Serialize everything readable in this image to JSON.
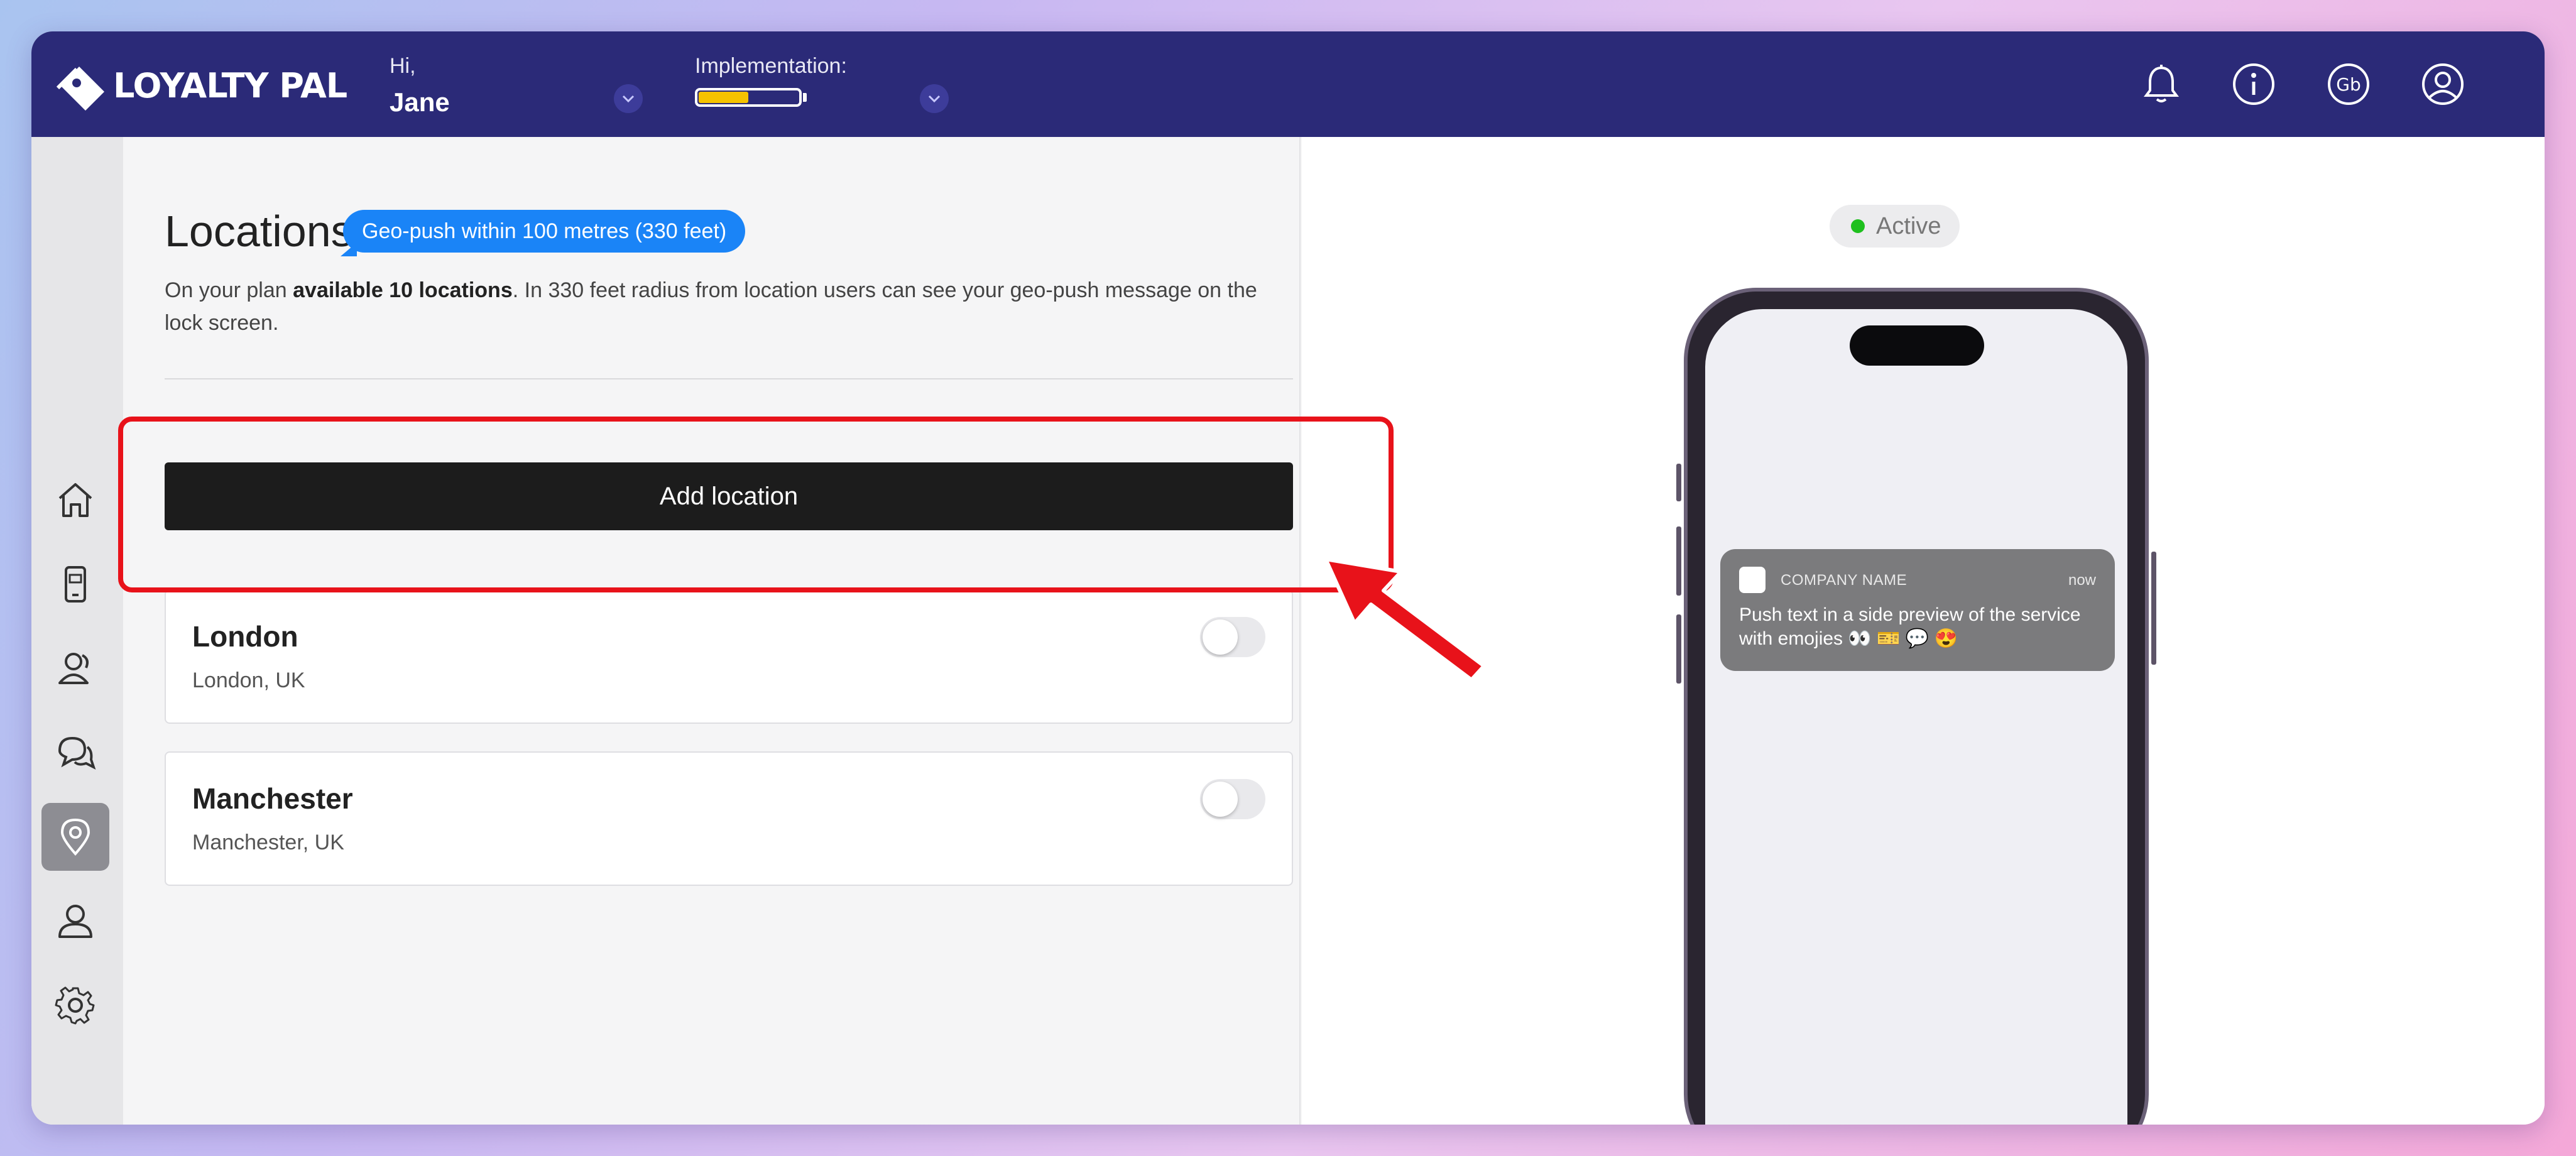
{
  "header": {
    "brand": "LOYALTY PAL",
    "greeting": "Hi,",
    "user_name": "Jane",
    "implementation_label": "Implementation:",
    "implementation_progress": 0.5
  },
  "rail": {
    "items": [
      {
        "name": "home",
        "icon": "home-icon",
        "active": false
      },
      {
        "name": "cards",
        "icon": "phone-card-icon",
        "active": false
      },
      {
        "name": "customers",
        "icon": "users-icon",
        "active": false
      },
      {
        "name": "messages",
        "icon": "chat-icon",
        "active": false
      },
      {
        "name": "locations",
        "icon": "location-pin-icon",
        "active": true
      },
      {
        "name": "account",
        "icon": "user-icon",
        "active": false
      },
      {
        "name": "settings",
        "icon": "gear-icon",
        "active": false
      }
    ]
  },
  "locations": {
    "title": "Locations",
    "badge": "Geo-push within 100 metres (330 feet)",
    "desc_prefix": "On your plan ",
    "desc_bold": "available 10 locations",
    "desc_suffix": ". In 330 feet radius from location users can see your geo-push message on the lock screen.",
    "add_button": "Add location",
    "items": [
      {
        "name": "London",
        "address": "London, UK",
        "enabled": false
      },
      {
        "name": "Manchester",
        "address": "Manchester, UK",
        "enabled": false
      }
    ]
  },
  "preview": {
    "status": "Active",
    "status_color": "#1ec01e",
    "notification": {
      "company": "COMPANY NAME",
      "time": "now",
      "body": "Push text in a side preview of the service with emojies 👀 🎫 💬 😍"
    }
  },
  "colors": {
    "header_bg": "#2b2a78",
    "accent_blue": "#1a84f7",
    "highlight_red": "#e8121a",
    "progress_yellow": "#f5c200"
  }
}
